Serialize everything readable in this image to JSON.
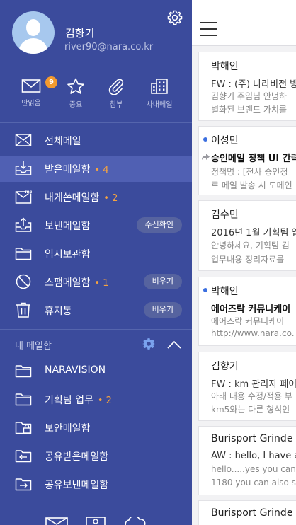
{
  "drawer": {
    "user": {
      "name": "김향기",
      "email": "river90@nara.co.kr"
    },
    "settings_icon": "gear-icon",
    "quick_actions": [
      {
        "id": "unread",
        "label": "안읽음",
        "icon": "envelope-icon",
        "badge": "9"
      },
      {
        "id": "important",
        "label": "중요",
        "icon": "star-icon"
      },
      {
        "id": "attachments",
        "label": "첨부",
        "icon": "paperclip-icon"
      },
      {
        "id": "company",
        "label": "사내메일",
        "icon": "building-icon"
      }
    ],
    "folders": [
      {
        "id": "all",
        "label": "전체메일",
        "icon": "all-mail-icon",
        "count": "",
        "action": ""
      },
      {
        "id": "inbox",
        "label": "받은메일함",
        "icon": "inbox-icon",
        "count": "4",
        "action": "",
        "active": true
      },
      {
        "id": "to-me",
        "label": "내게쓴메일함",
        "icon": "me-mail-icon",
        "count": "2",
        "action": ""
      },
      {
        "id": "sent",
        "label": "보낸메일함",
        "icon": "sent-icon",
        "count": "",
        "action": "수신확인"
      },
      {
        "id": "drafts",
        "label": "임시보관함",
        "icon": "folder-icon",
        "count": "",
        "action": ""
      },
      {
        "id": "spam",
        "label": "스팸메일함",
        "icon": "block-icon",
        "count": "1",
        "action": "비우기"
      },
      {
        "id": "trash",
        "label": "휴지통",
        "icon": "trash-icon",
        "count": "",
        "action": "비우기"
      }
    ],
    "my_mailboxes": {
      "title": "내 메일함",
      "items": [
        {
          "id": "naravision",
          "label": "NARAVISION",
          "icon": "folder-icon",
          "count": ""
        },
        {
          "id": "planning",
          "label": "기획팀 업무",
          "icon": "folder-icon",
          "count": "2"
        },
        {
          "id": "secure",
          "label": "보안메일함",
          "icon": "lock-folder-icon",
          "count": ""
        },
        {
          "id": "shared-in",
          "label": "공유받은메일함",
          "icon": "shared-inbox-icon",
          "count": ""
        },
        {
          "id": "shared-out",
          "label": "공유보낸메일함",
          "icon": "shared-sent-icon",
          "count": ""
        }
      ]
    }
  },
  "colors": {
    "drawer_bg": "#3b4b9c",
    "active_row": "#5060b3",
    "count_orange": "#f5a340",
    "badge_orange": "#f39a2e",
    "unread_dot": "#3b6fe0"
  },
  "mail_list": [
    {
      "sender": "박해인",
      "subject": "FW : (주) 나라비전 방",
      "preview": [
        "김향기 주임님 안녕하",
        "별화된 브랜드 가치를"
      ],
      "unread": false
    },
    {
      "sender": "이성민",
      "subject": "승인메일 정책 UI 간략",
      "preview": [
        "정책명 : [전사 승인정",
        "로 메일 발송 시 도메인"
      ],
      "unread": true,
      "forwarded": true
    },
    {
      "sender": "김수민",
      "subject": "2016년 1월 기획팀 업",
      "preview": [
        "안녕하세요, 기획팀 김",
        "업무내용 정리자료를"
      ],
      "unread": false
    },
    {
      "sender": "박해인",
      "subject": "에어즈락 커뮤니케이",
      "preview": [
        "에어즈락 커뮤니케이",
        "http://www.nara.co."
      ],
      "unread": true
    },
    {
      "sender": "김향기",
      "subject": "FW : km 관리자 페이",
      "preview": [
        "아래 내용 수정/적용 부",
        "km5와는 다른 형식인"
      ],
      "unread": false
    },
    {
      "sender": "Burisport Grinde",
      "subject": "AW : hello, I have a",
      "preview": [
        "hello.....yes you can",
        "1180 you can also s"
      ],
      "unread": false
    },
    {
      "sender": "Burisport Grinde",
      "subject": "",
      "preview": [],
      "unread": false
    }
  ]
}
